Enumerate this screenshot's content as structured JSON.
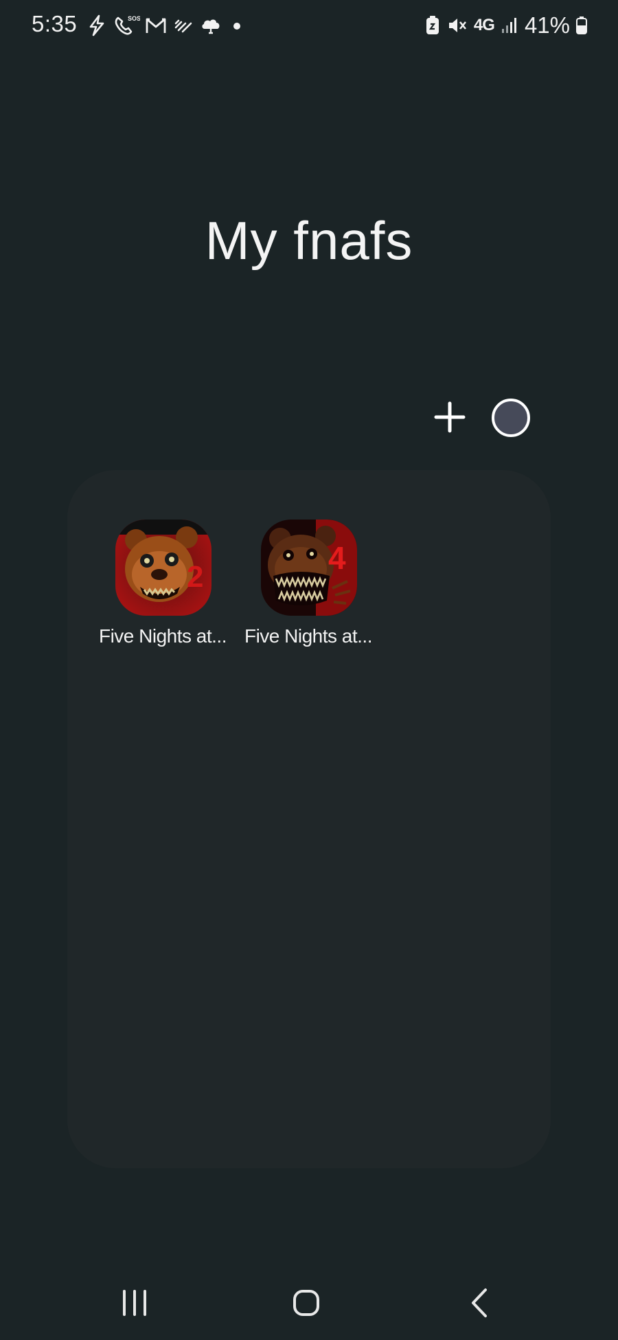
{
  "status_bar": {
    "time": "5:35",
    "left_icons": [
      "flash-icon",
      "wifi-calling-sos-icon",
      "gmail-icon",
      "weather-icon",
      "cloud-app-icon",
      "notification-dot-icon"
    ],
    "right_icons": [
      "battery-saver-icon",
      "mute-icon",
      "network-4g-icon",
      "signal-icon",
      "battery-icon"
    ],
    "network": "4G",
    "battery": "41%"
  },
  "folder": {
    "title": "My fnafs",
    "actions": {
      "add_icon": "plus-icon",
      "color_icon": "folder-color-icon",
      "color": "#464a59"
    },
    "apps": [
      {
        "label": "Five Nights at...",
        "icon": "fnaf2-app-icon",
        "badge": "2"
      },
      {
        "label": "Five Nights at...",
        "icon": "fnaf4-app-icon",
        "badge": "4"
      }
    ]
  },
  "nav_bar": {
    "recents_icon": "recents-icon",
    "home_icon": "home-icon",
    "back_icon": "back-icon"
  },
  "colors": {
    "background": "#1b2426",
    "folder_panel": "#202729",
    "text": "#ffffff"
  }
}
